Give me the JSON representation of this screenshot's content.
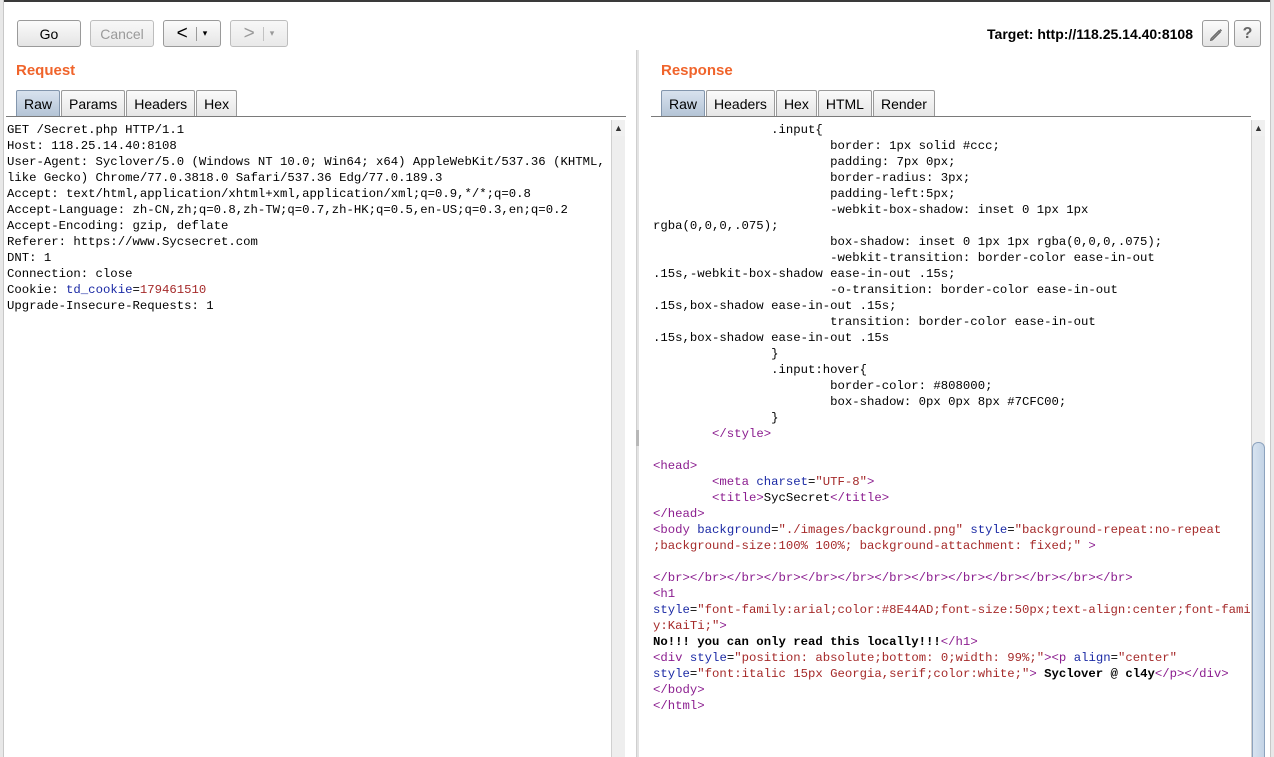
{
  "toolbar": {
    "go_label": "Go",
    "cancel_label": "Cancel",
    "back_symbol": "<",
    "forward_symbol": ">",
    "caret": "▾",
    "target_label": "Target: http://118.25.14.40:8108",
    "edit_icon": "pencil-icon",
    "help_icon": "help-icon",
    "help_symbol": "?"
  },
  "request": {
    "title": "Request",
    "tabs": [
      "Raw",
      "Params",
      "Headers",
      "Hex"
    ],
    "active_tab": "Raw",
    "lines": [
      "GET /Secret.php HTTP/1.1",
      "Host: 118.25.14.40:8108",
      "User-Agent: Syclover/5.0 (Windows NT 10.0; Win64; x64) AppleWebKit/537.36 (KHTML,",
      "like Gecko) Chrome/77.0.3818.0 Safari/537.36 Edg/77.0.189.3",
      "Accept: text/html,application/xhtml+xml,application/xml;q=0.9,*/*;q=0.8",
      "Accept-Language: zh-CN,zh;q=0.8,zh-TW;q=0.7,zh-HK;q=0.5,en-US;q=0.3,en;q=0.2",
      "Accept-Encoding: gzip, deflate",
      "Referer: https://www.Sycsecret.com",
      "DNT: 1",
      "Connection: close"
    ],
    "cookie_prefix": "Cookie: ",
    "cookie_name": "td_cookie",
    "cookie_eq": "=",
    "cookie_value": "179461510",
    "last_line": "Upgrade-Insecure-Requests: 1"
  },
  "response": {
    "title": "Response",
    "tabs": [
      "Raw",
      "Headers",
      "Hex",
      "HTML",
      "Render"
    ],
    "active_tab": "Raw",
    "css_lines": [
      "                .input{",
      "                        border: 1px solid #ccc;",
      "                        padding: 7px 0px;",
      "                        border-radius: 3px;",
      "                        padding-left:5px;",
      "                        -webkit-box-shadow: inset 0 1px 1px",
      "rgba(0,0,0,.075);",
      "                        box-shadow: inset 0 1px 1px rgba(0,0,0,.075);",
      "                        -webkit-transition: border-color ease-in-out",
      ".15s,-webkit-box-shadow ease-in-out .15s;",
      "                        -o-transition: border-color ease-in-out",
      ".15s,box-shadow ease-in-out .15s;",
      "                        transition: border-color ease-in-out",
      ".15s,box-shadow ease-in-out .15s",
      "                }",
      "                .input:hover{",
      "                        border-color: #808000;",
      "                        box-shadow: 0px 0px 8px #7CFC00;",
      "                }"
    ],
    "style_close": "</style>",
    "head_open": "<head>",
    "meta_tag_open": "<meta",
    "meta_attr": "charset",
    "meta_val": "\"UTF-8\"",
    "meta_close": ">",
    "title_open": "<title>",
    "title_text": "SycSecret",
    "title_close": "</title>",
    "head_close": "</head>",
    "body_tag": "<body",
    "body_attr1": "background",
    "body_val1": "\"./images/background.png\"",
    "body_attr2": "style",
    "body_val2a": "\"background-repeat:no-repeat",
    "body_val2b": ";background-size:100% 100%; background-attachment: fixed;\"",
    "body_gt": ">",
    "br_line": "</br></br></br></br></br></br></br></br></br></br></br></br></br>",
    "h1_open": "<h1",
    "h1_attr": "style",
    "h1_val_a": "\"font-family:arial;color:#8E44AD;font-size:50px;text-align:center;font-famil",
    "h1_val_b": "y:KaiTi;\"",
    "h1_gt": ">",
    "h1_text": "No!!! you can only read this locally!!!",
    "h1_close": "</h1>",
    "div_open": "<div",
    "div_attr": "style",
    "div_val": "\"position: absolute;bottom: 0;width: 99%;\"",
    "div_gt": ">",
    "p_open": "<p",
    "p_attr1": "align",
    "p_val1": "\"center\"",
    "p_attr2": "style",
    "p_val2": "\"font:italic 15px Georgia,serif;color:white;\"",
    "p_gt": ">",
    "p_text": " Syclover @ cl4y",
    "p_close": "</p>",
    "div_close": "</div>",
    "body_close": "</body>",
    "html_close": "</html>"
  },
  "colors": {
    "section_title": "#f0642b",
    "tag": "#8b1d8f",
    "attribute": "#1b2aa5",
    "value": "#a52a2a"
  }
}
